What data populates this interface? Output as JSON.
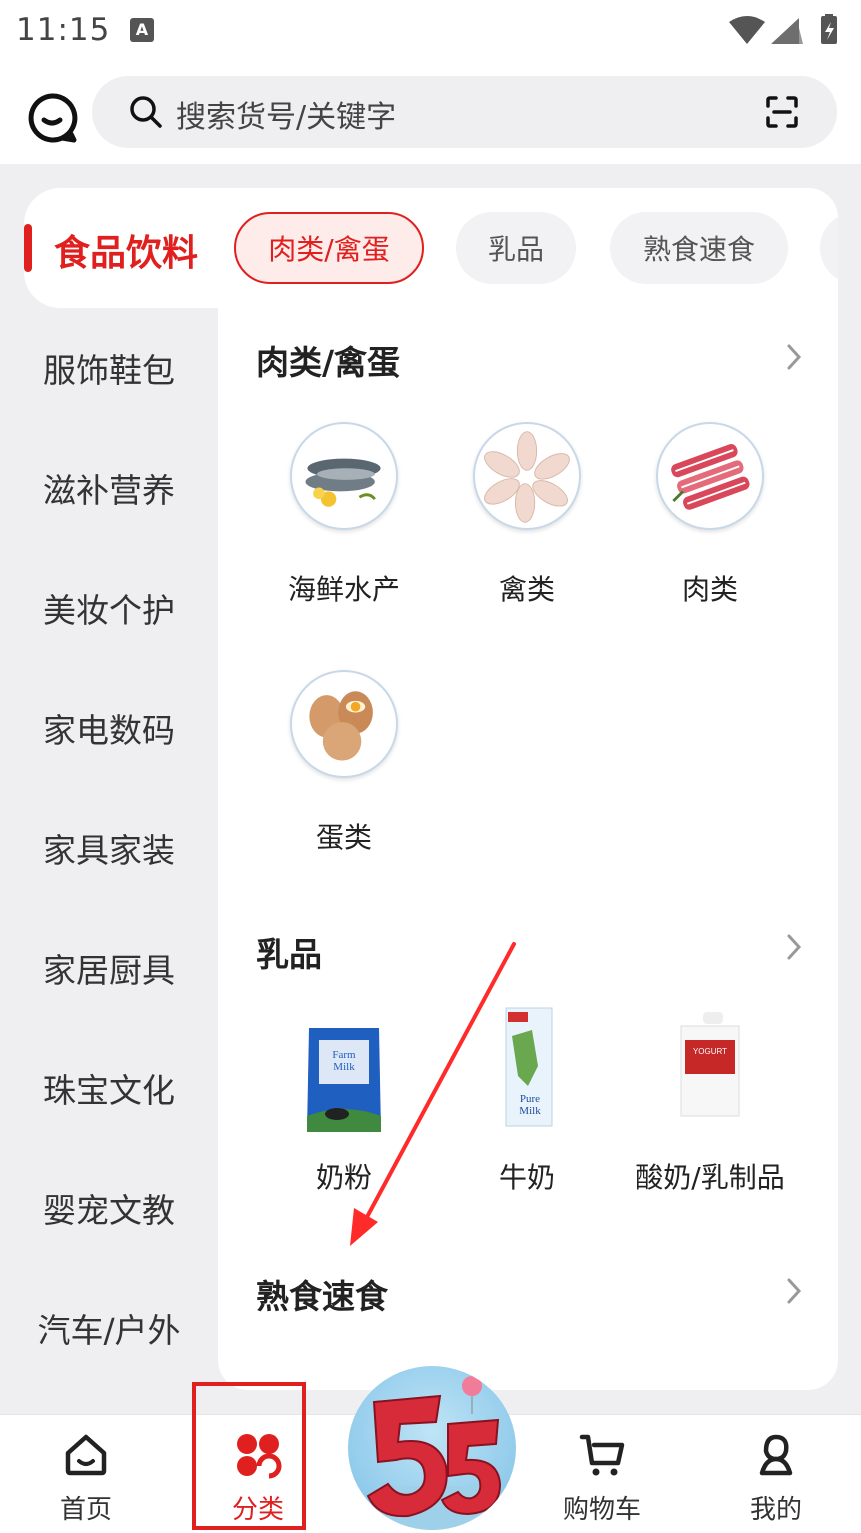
{
  "status_bar": {
    "time": "11:15",
    "a_icon": "A"
  },
  "header": {
    "search_placeholder": "搜索货号/关键字"
  },
  "sidebar": {
    "active": "食品饮料",
    "items": [
      "服饰鞋包",
      "滋补营养",
      "美妆个护",
      "家电数码",
      "家具家装",
      "家居厨具",
      "珠宝文化",
      "婴宠文教",
      "汽车/户外"
    ]
  },
  "tabs": [
    "肉类/禽蛋",
    "乳品",
    "熟食速食"
  ],
  "sections": [
    {
      "title": "肉类/禽蛋",
      "items": [
        {
          "label": "海鲜水产",
          "icon": "fish-icon"
        },
        {
          "label": "禽类",
          "icon": "chicken-icon"
        },
        {
          "label": "肉类",
          "icon": "meat-icon"
        },
        {
          "label": "蛋类",
          "icon": "egg-icon"
        }
      ]
    },
    {
      "title": "乳品",
      "items": [
        {
          "label": "奶粉",
          "icon": "milk-powder-icon"
        },
        {
          "label": "牛奶",
          "icon": "milk-carton-icon"
        },
        {
          "label": "酸奶/乳制品",
          "icon": "yogurt-icon"
        }
      ]
    },
    {
      "title": "熟食速食",
      "items": []
    }
  ],
  "bottom_nav": [
    {
      "label": "首页",
      "icon": "home-icon"
    },
    {
      "label": "分类",
      "icon": "category-icon",
      "active": true
    },
    {
      "label": "购物车",
      "icon": "cart-icon"
    },
    {
      "label": "我的",
      "icon": "profile-icon"
    }
  ],
  "colors": {
    "accent": "#e0201f",
    "background": "#efeff1"
  }
}
